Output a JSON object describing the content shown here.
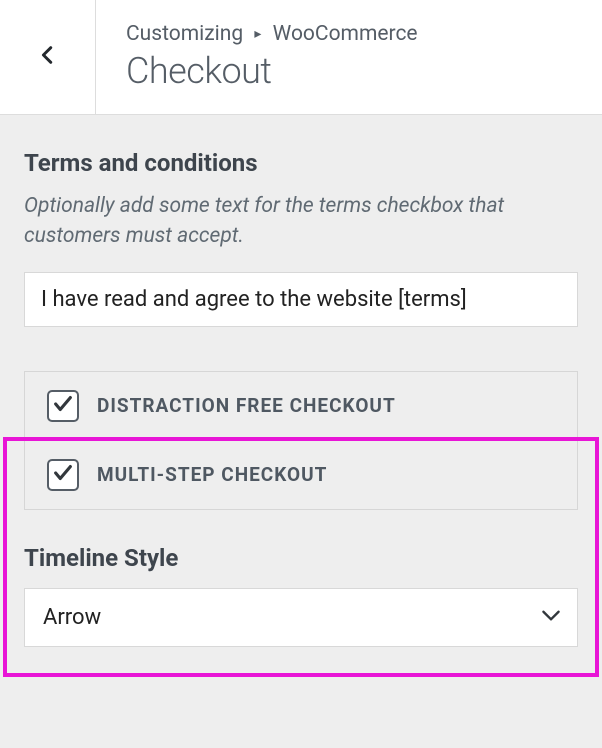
{
  "header": {
    "breadcrumb_prefix": "Customizing",
    "breadcrumb_section": "WooCommerce",
    "title": "Checkout"
  },
  "terms": {
    "heading": "Terms and conditions",
    "description": "Optionally add some text for the terms checkbox that customers must accept.",
    "input_value": "I have read and agree to the website [terms]"
  },
  "options": [
    {
      "label": "DISTRACTION FREE CHECKOUT",
      "checked": true
    },
    {
      "label": "MULTI-STEP CHECKOUT",
      "checked": true
    }
  ],
  "timeline": {
    "label": "Timeline Style",
    "selected": "Arrow"
  }
}
